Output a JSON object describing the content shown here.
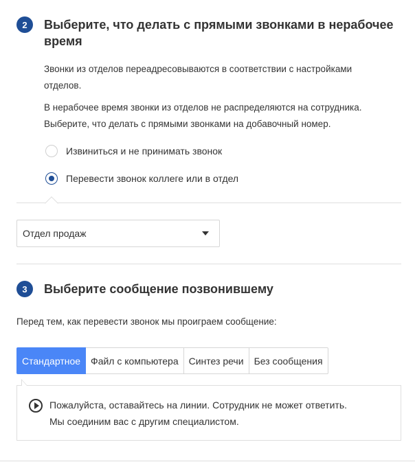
{
  "step2": {
    "number": "2",
    "title_line1": "Выберите, что делать с прямыми звонками в нерабочее",
    "title_line2": "время",
    "para1_line1": "Звонки из отделов переадресовываются в соответствии с настройками",
    "para1_line2": "отделов.",
    "para2_line1": "В нерабочее время звонки из отделов не распределяются на сотрудника.",
    "para2_line2": "Выберите, что делать с прямыми звонками на добавочный номер.",
    "options": [
      {
        "label": "Извиниться и не принимать звонок",
        "checked": false
      },
      {
        "label": "Перевести звонок коллеге или в отдел",
        "checked": true
      }
    ],
    "select": {
      "value": "Отдел продаж"
    }
  },
  "step3": {
    "number": "3",
    "title": "Выберите сообщение позвонившему",
    "intro": "Перед тем, как перевести звонок мы проиграем сообщение:",
    "tabs": [
      {
        "label": "Стандартное",
        "active": true
      },
      {
        "label": "Файл с компьютера",
        "active": false
      },
      {
        "label": "Синтез речи",
        "active": false
      },
      {
        "label": "Без сообщения",
        "active": false
      }
    ],
    "message_line1": "Пожалуйста, оставайтесь на линии. Сотрудник не может ответить.",
    "message_line2": "Мы соединим вас с другим специалистом."
  },
  "colors": {
    "badge": "#1f4e96",
    "active_tab": "#4a86f7",
    "border": "#dedede"
  },
  "icons": {
    "dropdown": "caret-down-icon",
    "play": "play-circle-icon"
  }
}
